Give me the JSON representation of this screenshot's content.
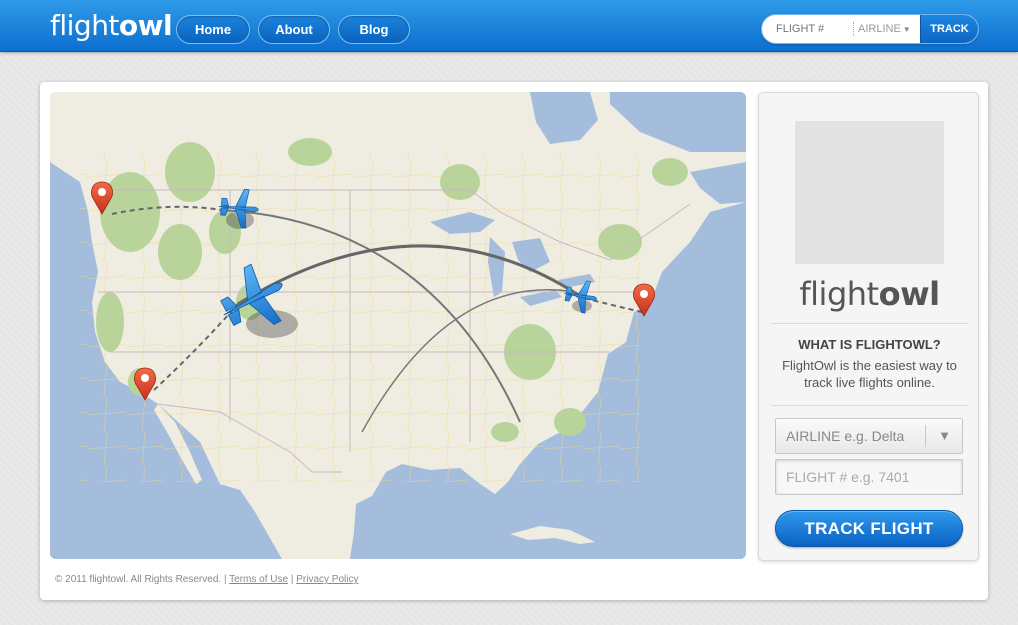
{
  "header": {
    "logo_light": "flight",
    "logo_bold": "owl",
    "nav": [
      {
        "label": "Home"
      },
      {
        "label": "About"
      },
      {
        "label": "Blog"
      }
    ],
    "quick_track": {
      "flight_placeholder": "FLIGHT #",
      "airline_label": "AIRLINE",
      "button_label": "TRACK"
    }
  },
  "sidebar": {
    "logo_light": "flight",
    "logo_bold": "owl",
    "heading": "WHAT IS FLIGHTOWL?",
    "description": "FlightOwl is the easiest way to track live flights online.",
    "airline_select": "AIRLINE e.g. Delta",
    "flight_placeholder": "FLIGHT # e.g. 7401",
    "track_button": "TRACK FLIGHT"
  },
  "footer": {
    "copyright": "© 2011 flightowl. All Rights Reserved.",
    "separator": "|",
    "terms": "Terms of Use",
    "privacy": "Privacy Policy"
  },
  "map": {
    "markers": [
      "seattle-marker",
      "los-angeles-marker",
      "boston-marker"
    ],
    "planes": 3
  },
  "colors": {
    "header_blue": "#1a82dd",
    "marker_red": "#e8452a",
    "plane_blue": "#2b8fe0",
    "water": "#a4bddc",
    "land": "#f0ede3"
  }
}
